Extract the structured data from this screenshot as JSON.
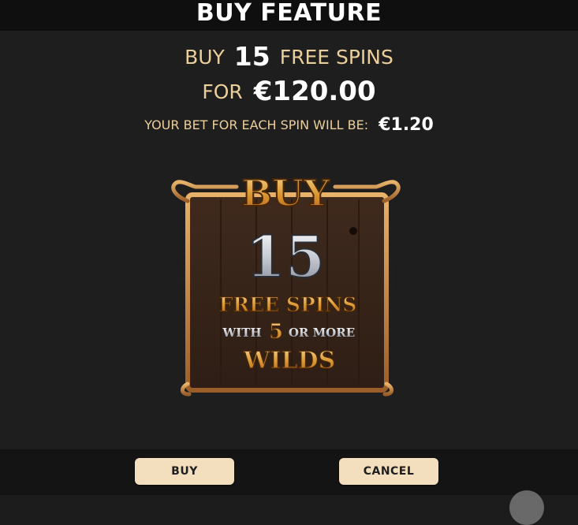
{
  "header": {
    "title": "BUY FEATURE"
  },
  "offer": {
    "buy_prefix": "BUY",
    "spins_count": "15",
    "spins_suffix": "FREE SPINS",
    "for_label": "FOR",
    "price": "€120.00",
    "bet_label": "YOUR BET FOR EACH SPIN WILL BE:",
    "bet_value": "€1.20"
  },
  "badge": {
    "buy_text": "BUY",
    "count": "15",
    "free_spins_text": "FREE SPINS",
    "with_text": "WITH",
    "threshold": "5",
    "or_more_text": "OR MORE",
    "wilds_text": "WILDS"
  },
  "actions": {
    "buy_label": "BUY",
    "cancel_label": "CANCEL"
  },
  "colors": {
    "accent_text": "#ebcf9b",
    "button_bg": "#f3dfbd",
    "gold": "#d9a441",
    "wood": "#4a2f1f"
  }
}
